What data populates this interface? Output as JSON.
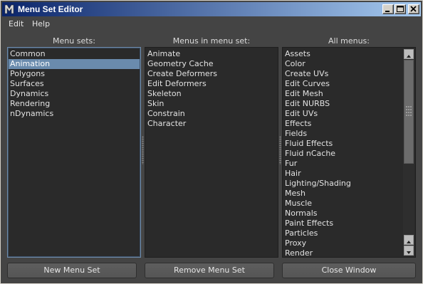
{
  "window": {
    "title": "Menu Set Editor"
  },
  "menubar": {
    "edit": "Edit",
    "help": "Help"
  },
  "columns": {
    "menu_sets_header": "Menu sets:",
    "menus_in_set_header": "Menus in menu set:",
    "all_menus_header": "All menus:"
  },
  "menu_sets": {
    "items": [
      "Common",
      "Animation",
      "Polygons",
      "Surfaces",
      "Dynamics",
      "Rendering",
      "nDynamics"
    ],
    "selected": "Animation"
  },
  "menus_in_set": {
    "items": [
      "Animate",
      "Geometry Cache",
      "Create Deformers",
      "Edit Deformers",
      "Skeleton",
      "Skin",
      "Constrain",
      "Character"
    ]
  },
  "all_menus": {
    "items": [
      "Assets",
      "Color",
      "Create UVs",
      "Edit Curves",
      "Edit Mesh",
      "Edit NURBS",
      "Edit UVs",
      "Effects",
      "Fields",
      "Fluid Effects",
      "Fluid nCache",
      "Fur",
      "Hair",
      "Lighting/Shading",
      "Mesh",
      "Muscle",
      "Normals",
      "Paint Effects",
      "Particles",
      "Proxy",
      "Render"
    ]
  },
  "buttons": {
    "new_menu_set": "New Menu Set",
    "remove_menu_set": "Remove Menu Set",
    "close_window": "Close Window"
  },
  "icons": {
    "app": "maya-app-icon",
    "minimize": "minimize-icon",
    "maximize": "maximize-icon",
    "close": "close-icon",
    "scroll_up": "chevron-up-icon",
    "scroll_down": "chevron-down-icon"
  },
  "colors": {
    "title_gradient_start": "#0a246a",
    "title_gradient_end": "#a6caf0",
    "panel_bg": "#444444",
    "list_bg": "#2a2a2a",
    "selection": "#6a8bad"
  }
}
